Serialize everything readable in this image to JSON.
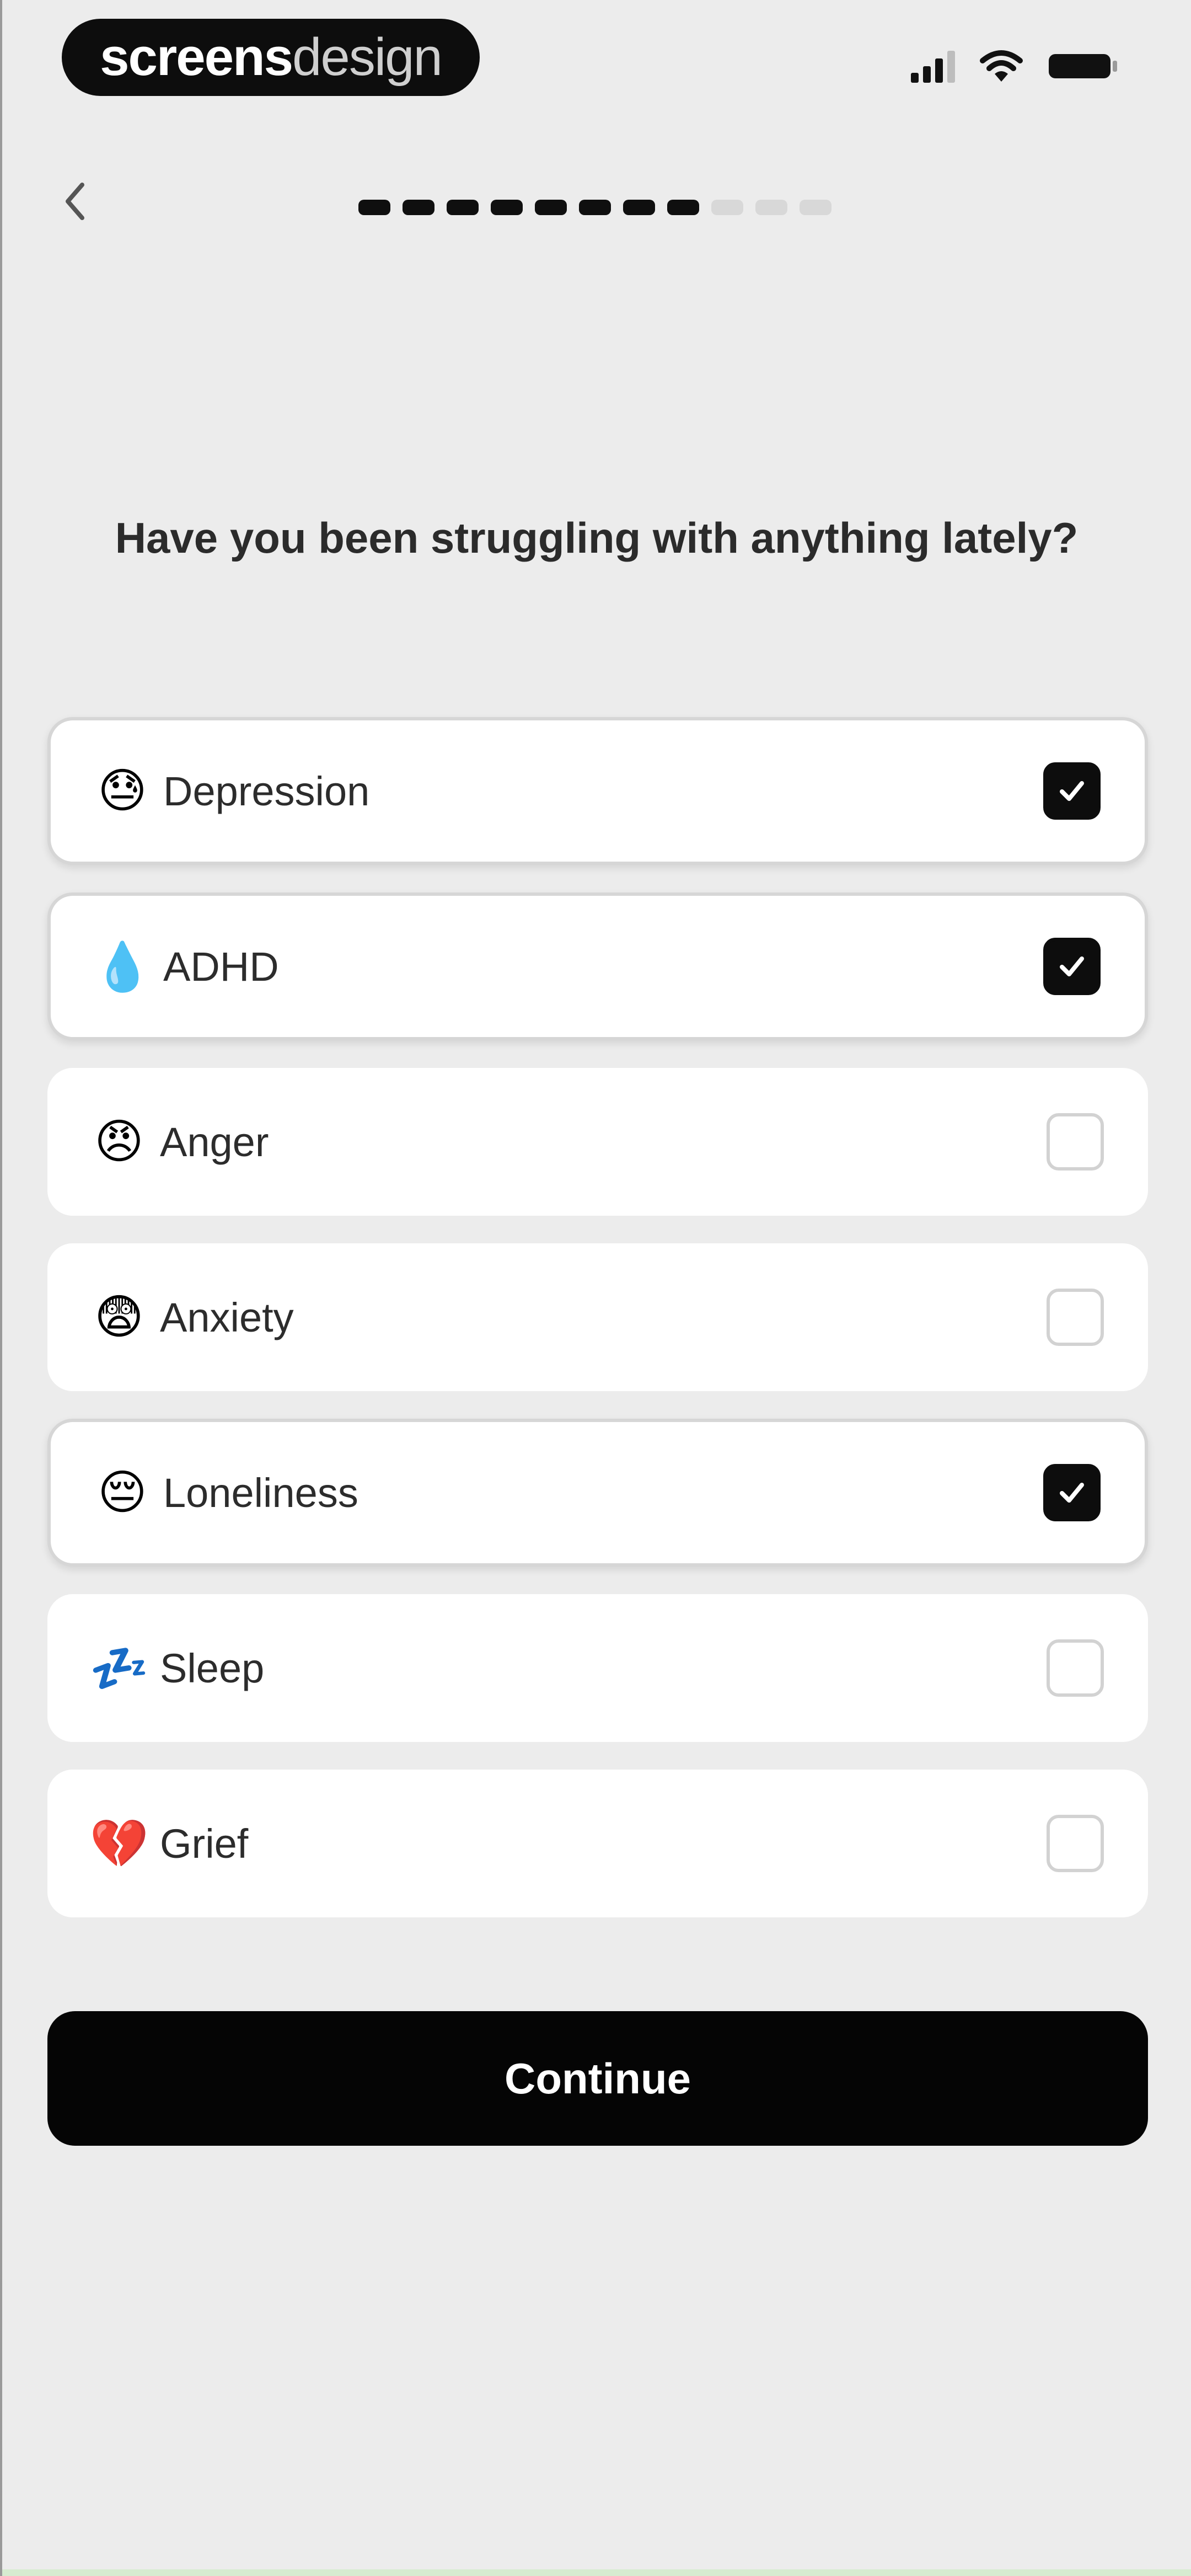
{
  "status_bar": {
    "brand_bold": "screens",
    "brand_light": "design",
    "icons": [
      "signal-icon",
      "wifi-icon",
      "battery-icon"
    ]
  },
  "header": {
    "back_icon": "chevron-left-icon",
    "progress": {
      "completed_steps": 8,
      "total_steps": 11
    }
  },
  "question": "Have you been struggling with anything lately?",
  "options": [
    {
      "emoji": "😓",
      "label": "Depression",
      "checked": true
    },
    {
      "emoji": "💧",
      "label": "ADHD",
      "checked": true
    },
    {
      "emoji": "😠",
      "label": "Anger",
      "checked": false
    },
    {
      "emoji": "😨",
      "label": "Anxiety",
      "checked": false
    },
    {
      "emoji": "😔",
      "label": "Loneliness",
      "checked": true
    },
    {
      "emoji": "💤",
      "label": "Sleep",
      "checked": false
    },
    {
      "emoji": "💔",
      "label": "Grief",
      "checked": false
    }
  ],
  "continue_label": "Continue",
  "colors": {
    "background": "#ececec",
    "primary": "#050505",
    "card": "#ffffff"
  }
}
